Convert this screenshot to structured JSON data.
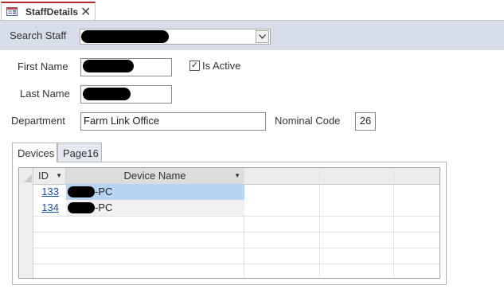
{
  "window": {
    "tab_title": "StaffDetails",
    "close_icon": "close-icon",
    "form_icon": "form-icon"
  },
  "search": {
    "label": "Search Staff",
    "value_redacted": true
  },
  "fields": {
    "first_name_label": "First Name",
    "last_name_label": "Last Name",
    "is_active_label": "Is Active",
    "is_active_checked": true,
    "is_active_mark": "✓",
    "department_label": "Department",
    "department_value": "Farm Link Office",
    "nominal_code_label": "Nominal Code",
    "nominal_code_value": "26"
  },
  "subform_tabs": [
    {
      "label": "Devices",
      "active": true
    },
    {
      "label": "Page16",
      "active": false
    }
  ],
  "devices_grid": {
    "columns": [
      "ID",
      "Device Name"
    ],
    "rows": [
      {
        "id": "133",
        "device_name_suffix": "-PC",
        "selected": true
      },
      {
        "id": "134",
        "device_name_suffix": "-PC",
        "selected": false
      }
    ]
  },
  "colors": {
    "header_band": "#d8dee9",
    "tab_accent": "#b02b2b",
    "selected_row": "#b7d5f3",
    "link": "#1a4fa0"
  }
}
